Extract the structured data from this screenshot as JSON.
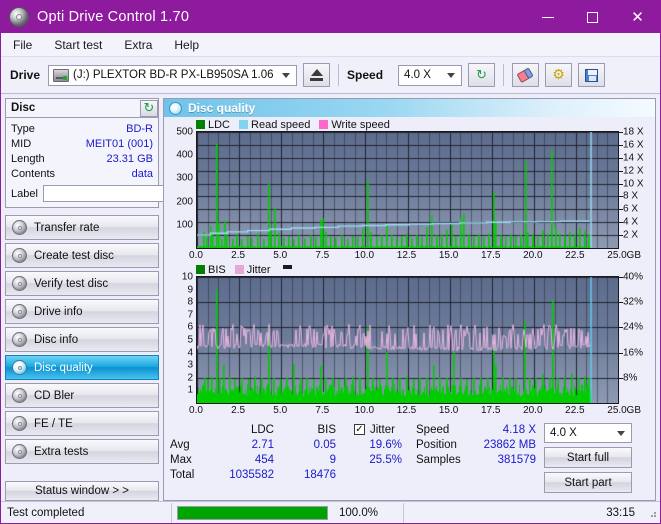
{
  "window": {
    "title": "Opti Drive Control 1.70",
    "icon": "disc-icon",
    "minimize": "—",
    "maximize": "□",
    "close": "✕"
  },
  "menu": {
    "items": [
      "File",
      "Start test",
      "Extra",
      "Help"
    ]
  },
  "toolbar": {
    "drive_label": "Drive",
    "drive_value": "(J:)  PLEXTOR BD-R  PX-LB950SA 1.06",
    "eject_title": "Eject",
    "speed_label": "Speed",
    "speed_value": "4.0 X",
    "refresh_icon": "↻",
    "tools_icon": "⚙"
  },
  "disc": {
    "title": "Disc",
    "refresh_icon": "↻",
    "rows": [
      {
        "key": "Type",
        "value": "BD-R"
      },
      {
        "key": "MID",
        "value": "MEIT01 (001)"
      },
      {
        "key": "Length",
        "value": "23.31 GB"
      },
      {
        "key": "Contents",
        "value": "data"
      }
    ],
    "label_key": "Label",
    "label_value": "",
    "label_placeholder": ""
  },
  "sidebar": {
    "items": [
      {
        "label": "Transfer rate",
        "selected": false
      },
      {
        "label": "Create test disc",
        "selected": false
      },
      {
        "label": "Verify test disc",
        "selected": false
      },
      {
        "label": "Drive info",
        "selected": false
      },
      {
        "label": "Disc info",
        "selected": false
      },
      {
        "label": "Disc quality",
        "selected": true
      },
      {
        "label": "CD Bler",
        "selected": false
      },
      {
        "label": "FE / TE",
        "selected": false
      },
      {
        "label": "Extra tests",
        "selected": false
      }
    ],
    "status_button": "Status window > >"
  },
  "main": {
    "title": "Disc quality"
  },
  "stats": {
    "col_headers": [
      "LDC",
      "BIS"
    ],
    "rows": [
      {
        "key": "Avg",
        "ldc": "2.71",
        "bis": "0.05"
      },
      {
        "key": "Max",
        "ldc": "454",
        "bis": "9"
      },
      {
        "key": "Total",
        "ldc": "1035582",
        "bis": "18476"
      }
    ],
    "jitter_label": "Jitter",
    "jitter_checked": true,
    "jitter_checkmark": "✓",
    "jitter_avg": "19.6%",
    "jitter_max": "25.5%",
    "speed_key": "Speed",
    "speed_value": "4.18 X",
    "position_key": "Position",
    "position_value": "23862 MB",
    "samples_key": "Samples",
    "samples_value": "381579",
    "speed_select": "4.0 X",
    "start_full": "Start full",
    "start_part": "Start part"
  },
  "statusbar": {
    "message": "Test completed",
    "percent_label": "100.0%",
    "percent_value": 100,
    "time": "33:15"
  },
  "chart_data": [
    {
      "type": "line",
      "id": "ldc-chart",
      "title": "Disc quality",
      "xlabel": "GB",
      "ylabel": "",
      "xlim": [
        0,
        25
      ],
      "ylim": [
        0,
        500
      ],
      "y2lim": [
        0,
        18
      ],
      "xticks": [
        "0.0",
        "2.5",
        "5.0",
        "7.5",
        "10.0",
        "12.5",
        "15.0",
        "17.5",
        "20.0",
        "22.5",
        "25.0"
      ],
      "xtickvals": [
        0,
        2.5,
        5,
        7.5,
        10,
        12.5,
        15,
        17.5,
        20,
        22.5,
        25
      ],
      "yticks": [
        "100",
        "200",
        "300",
        "400",
        "500"
      ],
      "ytickvals": [
        100,
        200,
        300,
        400,
        500
      ],
      "y2ticks": [
        "2 X",
        "4 X",
        "6 X",
        "8 X",
        "10 X",
        "12 X",
        "14 X",
        "16 X",
        "18 X"
      ],
      "y2tickvals": [
        2,
        4,
        6,
        8,
        10,
        12,
        14,
        16,
        18
      ],
      "grid": true,
      "legend_position": "top-left",
      "legend": [
        {
          "label": "LDC",
          "color": "#008000"
        },
        {
          "label": "Read speed",
          "color": "#7fd4f2"
        },
        {
          "label": "Write speed",
          "color": "#ff66cc"
        }
      ],
      "data_end_x": 23.4,
      "series": [
        {
          "name": "LDC",
          "color": "#00cc00",
          "kind": "spikes",
          "avg": 2.71,
          "max": 454,
          "baseline": 6,
          "spikes": [
            [
              0.35,
              70
            ],
            [
              0.55,
              48
            ],
            [
              0.75,
              95
            ],
            [
              0.9,
              60
            ],
            [
              1.15,
              452
            ],
            [
              1.25,
              110
            ],
            [
              1.45,
              40
            ],
            [
              1.6,
              118
            ],
            [
              1.75,
              55
            ],
            [
              2.05,
              42
            ],
            [
              2.3,
              60
            ],
            [
              2.6,
              38
            ],
            [
              2.95,
              52
            ],
            [
              3.2,
              44
            ],
            [
              3.55,
              62
            ],
            [
              3.9,
              40
            ],
            [
              4.2,
              276
            ],
            [
              4.35,
              88
            ],
            [
              4.6,
              172
            ],
            [
              4.8,
              66
            ],
            [
              5.1,
              45
            ],
            [
              5.4,
              52
            ],
            [
              5.7,
              38
            ],
            [
              6.0,
              60
            ],
            [
              6.35,
              42
            ],
            [
              6.7,
              55
            ],
            [
              7.0,
              48
            ],
            [
              7.3,
              120
            ],
            [
              7.45,
              130
            ],
            [
              7.6,
              70
            ],
            [
              7.9,
              50
            ],
            [
              8.2,
              44
            ],
            [
              8.55,
              58
            ],
            [
              8.9,
              40
            ],
            [
              9.2,
              52
            ],
            [
              9.5,
              48
            ],
            [
              9.8,
              85
            ],
            [
              10.1,
              290
            ],
            [
              10.3,
              70
            ],
            [
              10.6,
              48
            ],
            [
              10.9,
              55
            ],
            [
              11.2,
              100
            ],
            [
              11.5,
              60
            ],
            [
              11.8,
              45
            ],
            [
              12.1,
              52
            ],
            [
              12.4,
              62
            ],
            [
              12.7,
              44
            ],
            [
              13.0,
              58
            ],
            [
              13.3,
              48
            ],
            [
              13.6,
              90
            ],
            [
              13.9,
              142
            ],
            [
              14.2,
              55
            ],
            [
              14.5,
              60
            ],
            [
              14.8,
              78
            ],
            [
              15.1,
              100
            ],
            [
              15.3,
              52
            ],
            [
              15.6,
              130
            ],
            [
              15.8,
              148
            ],
            [
              16.1,
              60
            ],
            [
              16.4,
              50
            ],
            [
              16.7,
              58
            ],
            [
              17.0,
              46
            ],
            [
              17.3,
              62
            ],
            [
              17.55,
              240
            ],
            [
              17.7,
              120
            ],
            [
              18.0,
              55
            ],
            [
              18.3,
              48
            ],
            [
              18.6,
              60
            ],
            [
              18.9,
              52
            ],
            [
              19.2,
              58
            ],
            [
              19.45,
              375
            ],
            [
              19.6,
              70
            ],
            [
              19.9,
              60
            ],
            [
              20.2,
              48
            ],
            [
              20.5,
              75
            ],
            [
              20.8,
              62
            ],
            [
              21.05,
              420
            ],
            [
              21.25,
              90
            ],
            [
              21.5,
              60
            ],
            [
              21.8,
              55
            ],
            [
              22.1,
              70
            ],
            [
              22.4,
              60
            ],
            [
              22.7,
              88
            ],
            [
              23.0,
              72
            ],
            [
              23.2,
              58
            ]
          ]
        },
        {
          "name": "Read speed",
          "color": "#9adcf5",
          "kind": "step",
          "points": [
            [
              0,
              2.0
            ],
            [
              0.8,
              2.3
            ],
            [
              1.8,
              2.5
            ],
            [
              3.0,
              2.7
            ],
            [
              4.3,
              2.9
            ],
            [
              5.6,
              3.1
            ],
            [
              7.0,
              3.2
            ],
            [
              8.4,
              3.4
            ],
            [
              9.8,
              3.5
            ],
            [
              11.2,
              3.6
            ],
            [
              12.6,
              3.7
            ],
            [
              14.0,
              3.8
            ],
            [
              15.6,
              3.9
            ],
            [
              17.2,
              4.0
            ],
            [
              18.6,
              4.05
            ],
            [
              20.2,
              4.1
            ],
            [
              21.6,
              4.15
            ],
            [
              23.3,
              4.18
            ]
          ]
        },
        {
          "name": "Write speed",
          "color": "#ff66cc",
          "kind": "none",
          "points": []
        }
      ]
    },
    {
      "type": "line",
      "id": "bis-chart",
      "xlabel": "GB",
      "xlim": [
        0,
        25
      ],
      "ylim": [
        0,
        10
      ],
      "y2lim": [
        0,
        40
      ],
      "xticks": [
        "0.0",
        "2.5",
        "5.0",
        "7.5",
        "10.0",
        "12.5",
        "15.0",
        "17.5",
        "20.0",
        "22.5",
        "25.0"
      ],
      "xtickvals": [
        0,
        2.5,
        5,
        7.5,
        10,
        12.5,
        15,
        17.5,
        20,
        22.5,
        25
      ],
      "yticks": [
        "1",
        "2",
        "3",
        "4",
        "5",
        "6",
        "7",
        "8",
        "9",
        "10"
      ],
      "ytickvals": [
        1,
        2,
        3,
        4,
        5,
        6,
        7,
        8,
        9,
        10
      ],
      "y2ticks": [
        "8%",
        "16%",
        "24%",
        "32%",
        "40%"
      ],
      "y2tickvals": [
        8,
        16,
        24,
        32,
        40
      ],
      "grid": true,
      "legend_position": "top-left",
      "legend": [
        {
          "label": "BIS",
          "color": "#008000"
        },
        {
          "label": "Jitter",
          "color": "#e5a8d8"
        }
      ],
      "data_end_x": 23.4,
      "series": [
        {
          "name": "BIS",
          "color": "#00cc00",
          "kind": "spikes",
          "avg": 0.05,
          "max": 9,
          "baseline": 1.0,
          "spikes": [
            [
              0.4,
              2.0
            ],
            [
              0.6,
              1.9
            ],
            [
              0.85,
              2.1
            ],
            [
              1.15,
              9.0
            ],
            [
              1.3,
              2.0
            ],
            [
              1.55,
              3.0
            ],
            [
              1.9,
              2.0
            ],
            [
              2.2,
              1.9
            ],
            [
              2.6,
              2.0
            ],
            [
              3.0,
              1.9
            ],
            [
              3.4,
              2.1
            ],
            [
              3.8,
              2.0
            ],
            [
              4.2,
              6.0
            ],
            [
              4.5,
              2.0
            ],
            [
              4.9,
              1.9
            ],
            [
              5.3,
              2.0
            ],
            [
              5.7,
              3.1
            ],
            [
              6.1,
              2.0
            ],
            [
              6.5,
              2.0
            ],
            [
              6.9,
              1.9
            ],
            [
              7.3,
              3.0
            ],
            [
              7.6,
              2.0
            ],
            [
              8.0,
              2.0
            ],
            [
              8.4,
              1.9
            ],
            [
              8.8,
              2.0
            ],
            [
              9.2,
              2.1
            ],
            [
              9.6,
              2.0
            ],
            [
              10.1,
              6.0
            ],
            [
              10.4,
              2.0
            ],
            [
              10.8,
              1.9
            ],
            [
              11.2,
              4.0
            ],
            [
              11.6,
              2.0
            ],
            [
              12.0,
              2.0
            ],
            [
              12.4,
              2.1
            ],
            [
              12.8,
              1.9
            ],
            [
              13.2,
              2.0
            ],
            [
              13.6,
              2.0
            ],
            [
              14.0,
              3.0
            ],
            [
              14.4,
              2.0
            ],
            [
              14.8,
              2.0
            ],
            [
              15.2,
              4.0
            ],
            [
              15.6,
              2.0
            ],
            [
              16.0,
              1.9
            ],
            [
              16.4,
              2.0
            ],
            [
              16.8,
              2.0
            ],
            [
              17.2,
              2.0
            ],
            [
              17.55,
              5.0
            ],
            [
              17.7,
              3.0
            ],
            [
              18.1,
              2.0
            ],
            [
              18.5,
              2.0
            ],
            [
              18.9,
              2.0
            ],
            [
              19.4,
              6.5
            ],
            [
              19.7,
              2.0
            ],
            [
              20.1,
              2.0
            ],
            [
              20.5,
              2.3
            ],
            [
              20.9,
              2.0
            ],
            [
              21.1,
              8.2
            ],
            [
              21.4,
              2.0
            ],
            [
              21.8,
              2.0
            ],
            [
              22.2,
              2.4
            ],
            [
              22.6,
              2.0
            ],
            [
              23.0,
              2.1
            ],
            [
              23.2,
              2.0
            ]
          ]
        },
        {
          "name": "Jitter",
          "color": "#e8b4e0",
          "kind": "noise",
          "avg": 19.6,
          "max": 25.5,
          "band_low": 16.5,
          "band_high": 25.0
        }
      ]
    }
  ]
}
